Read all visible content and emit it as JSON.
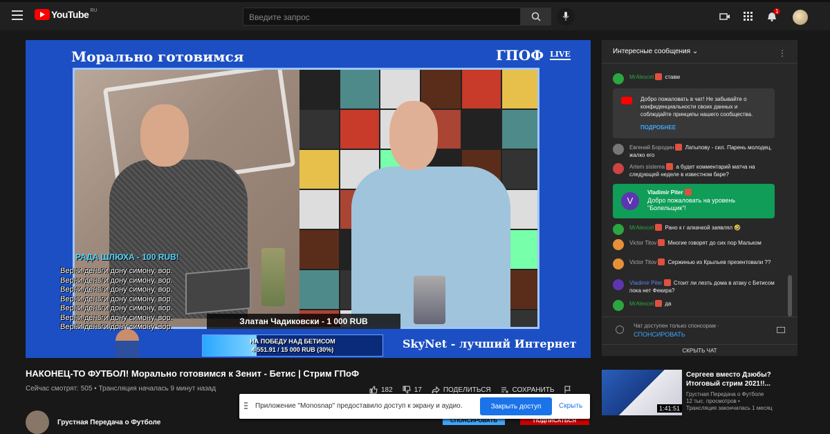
{
  "header": {
    "logo_text": "YouTube",
    "logo_region": "RU",
    "search_placeholder": "Введите запрос",
    "notification_count": "1"
  },
  "video": {
    "overlay_title": "Морально готовимся",
    "overlay_brand": "ГПОФ",
    "overlay_live": "LIVE",
    "donor_line": "РАДА ШЛЮХА - 100 RUB!",
    "repeat_lines": [
      "Верни деньги дону симону, вор.",
      "Верни деньги дону симону, вор.",
      "Верни деньги дону симону, вор.",
      "Верни деньги дону симону, вор.",
      "Верни деньги дону симону, вор.",
      "Верни деньги дону симону, вор.",
      "Верни деньги дону симону, вор."
    ],
    "nameplate": "Златан Чадиковски - 1 000 RUB",
    "goal_label": "НА ПОБЕДУ НАД БЕТИСОМ",
    "goal_progress": "4 551.91 / 15 000 RUB (30%)",
    "goal_fraction": 0.3,
    "sponsor": "SkyNet - лучший Интернет"
  },
  "meta": {
    "title": "НАКОНЕЦ-ТО ФУТБОЛ! Морально готовимся к Зенит - Бетис | Стрим ГПоФ",
    "viewers": "Сейчас смотрят: 505 • Трансляция началась 9 минут назад",
    "likes": "182",
    "dislikes": "17",
    "share": "ПОДЕЛИТЬСЯ",
    "save": "СОХРАНИТЬ",
    "channel_name": "Грустная Передача о Футболе",
    "sponsor_btn": "СПОНСИРОВАТЬ",
    "subscribe_btn": "ПОДПИСАТЬСЯ"
  },
  "notice": {
    "text": "Приложение \"Monosnap\" предоставило доступ к экрану и аудио.",
    "close_btn": "Закрыть доступ",
    "hide": "Скрыть"
  },
  "chat": {
    "header": "Интересные сообщения",
    "messages_top": [
      {
        "name": "MrAlexcel",
        "text": "ставм",
        "color": "#2ba640"
      }
    ],
    "welcome_text": "Добро пожаловать в чат! Не забывайте о конфиденциальности своих данных и соблюдайте принципы нашего сообщества.",
    "welcome_link": "ПОДРОБНЕЕ",
    "messages_mid": [
      {
        "name": "Евгений Бородин",
        "text": "Латыпову - сил. Парень молодец, жалко его"
      },
      {
        "name": "Artem sistema",
        "text": "а будет комментарий матча на следующей неделе в известном баре?"
      }
    ],
    "promo_name": "Vladimir Piter",
    "promo_letter": "V",
    "promo_text": "Добро пожаловать на уровень \"Болельщик\"!",
    "messages_bottom": [
      {
        "name": "MrAlexcel",
        "text": "Рано к г алкачкой заявлял 🤣"
      },
      {
        "name": "Victor Titov",
        "text": "Многие говорят до сих пор Мальком"
      },
      {
        "name": "Victor Titov",
        "text": "Сержинью из Крыльев презентовали ??"
      },
      {
        "name": "Vladimir Piter",
        "text": "Стоит ли лезть дома в атаку с Бетисом пока нет Фекира?"
      },
      {
        "name": "MrAlexcel",
        "text": "да"
      }
    ],
    "footer_line1": "Чат доступен только спонсорам ·",
    "footer_line2": "СПОНСИРОВАТЬ",
    "hide_chat": "СКРЫТЬ ЧАТ"
  },
  "recommended": {
    "title": "Сергеев вместо Дзюбы? Итоговый стрим 2021!!...",
    "channel": "Грустная Передача о Футболе",
    "stats": "12 тыс. просмотров •",
    "status": "Трансляция закончилась 1 месяц",
    "duration": "1:41:51"
  },
  "colors": {
    "video_bg": "#1c4fc3",
    "accent": "#3ea6ff",
    "promo": "#0f9d58"
  }
}
